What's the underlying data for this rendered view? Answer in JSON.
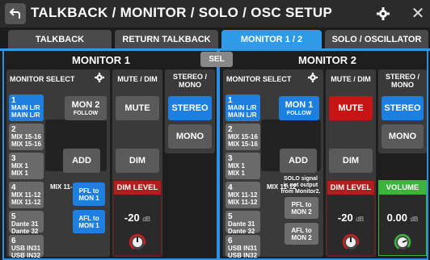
{
  "title": "TALKBACK / MONITOR / SOLO / OSC SETUP",
  "tabs": [
    "TALKBACK",
    "RETURN TALKBACK",
    "MONITOR 1 / 2",
    "SOLO / OSCILLATOR"
  ],
  "sel_label": "SEL",
  "monitor1": {
    "header": "MONITOR 1",
    "select_label": "MONITOR SELECT",
    "sources": [
      {
        "num": "1",
        "l1": "MAIN L/R",
        "l2": "MAIN L/R"
      },
      {
        "num": "2",
        "l1": "MIX 15-16",
        "l2": "MIX 15-16"
      },
      {
        "num": "3",
        "l1": "MIX 1",
        "l2": "MIX 1"
      },
      {
        "num": "4",
        "l1": "MIX 11-12",
        "l2": "MIX 11-12"
      },
      {
        "num": "5",
        "l1": "Dante 31",
        "l2": "Dante 32"
      },
      {
        "num": "6",
        "l1": "USB IN31",
        "l2": "USB IN32"
      }
    ],
    "follow_top": "MON 2",
    "follow_bottom": "FOLLOW",
    "selected_source": "MIX 11-12",
    "add_label": "ADD",
    "pfl_top": "PFL to",
    "pfl_bottom": "MON 1",
    "afl_top": "AFL to",
    "afl_bottom": "MON 1",
    "mute_dim_label": "MUTE / DIM",
    "mute_label": "MUTE",
    "dim_label": "DIM",
    "level_label": "DIM LEVEL",
    "level_value": "-20",
    "level_unit": "dB",
    "stereo_label_1": "STEREO /",
    "stereo_label_2": "MONO",
    "stereo_btn": "STEREO",
    "mono_btn": "MONO"
  },
  "monitor2": {
    "header": "MONITOR 2",
    "select_label": "MONITOR SELECT",
    "sources": [
      {
        "num": "1",
        "l1": "MAIN L/R",
        "l2": "MAIN L/R"
      },
      {
        "num": "2",
        "l1": "MIX 15-16",
        "l2": "MIX 15-16"
      },
      {
        "num": "3",
        "l1": "MIX 1",
        "l2": "MIX 1"
      },
      {
        "num": "4",
        "l1": "MIX 11-12",
        "l2": "MIX 11-12"
      },
      {
        "num": "5",
        "l1": "Dante 31",
        "l2": "Dante 32"
      },
      {
        "num": "6",
        "l1": "USB IN31",
        "l2": "USB IN32"
      }
    ],
    "follow_top": "MON 1",
    "follow_bottom": "FOLLOW",
    "selected_source": "MIX 11-12",
    "add_label": "ADD",
    "note1": "SOLO signal",
    "note2": "is not output",
    "note3": "from Monitor2.",
    "pfl_top": "PFL to",
    "pfl_bottom": "MON 2",
    "afl_top": "AFL to",
    "afl_bottom": "MON 2",
    "mute_dim_label": "MUTE / DIM",
    "mute_label": "MUTE",
    "dim_label": "DIM",
    "level_label": "DIM LEVEL",
    "level_value": "-20",
    "level_unit": "dB",
    "stereo_label_1": "STEREO /",
    "stereo_label_2": "MONO",
    "stereo_btn": "STEREO",
    "mono_btn": "MONO",
    "volume_label": "VOLUME",
    "volume_value": "0.00",
    "volume_unit": "dB"
  },
  "colors": {
    "accent": "#2f9be6",
    "active_blue": "#1e7fe0",
    "mute_red": "#c81414",
    "volume_green": "#3db33d"
  }
}
